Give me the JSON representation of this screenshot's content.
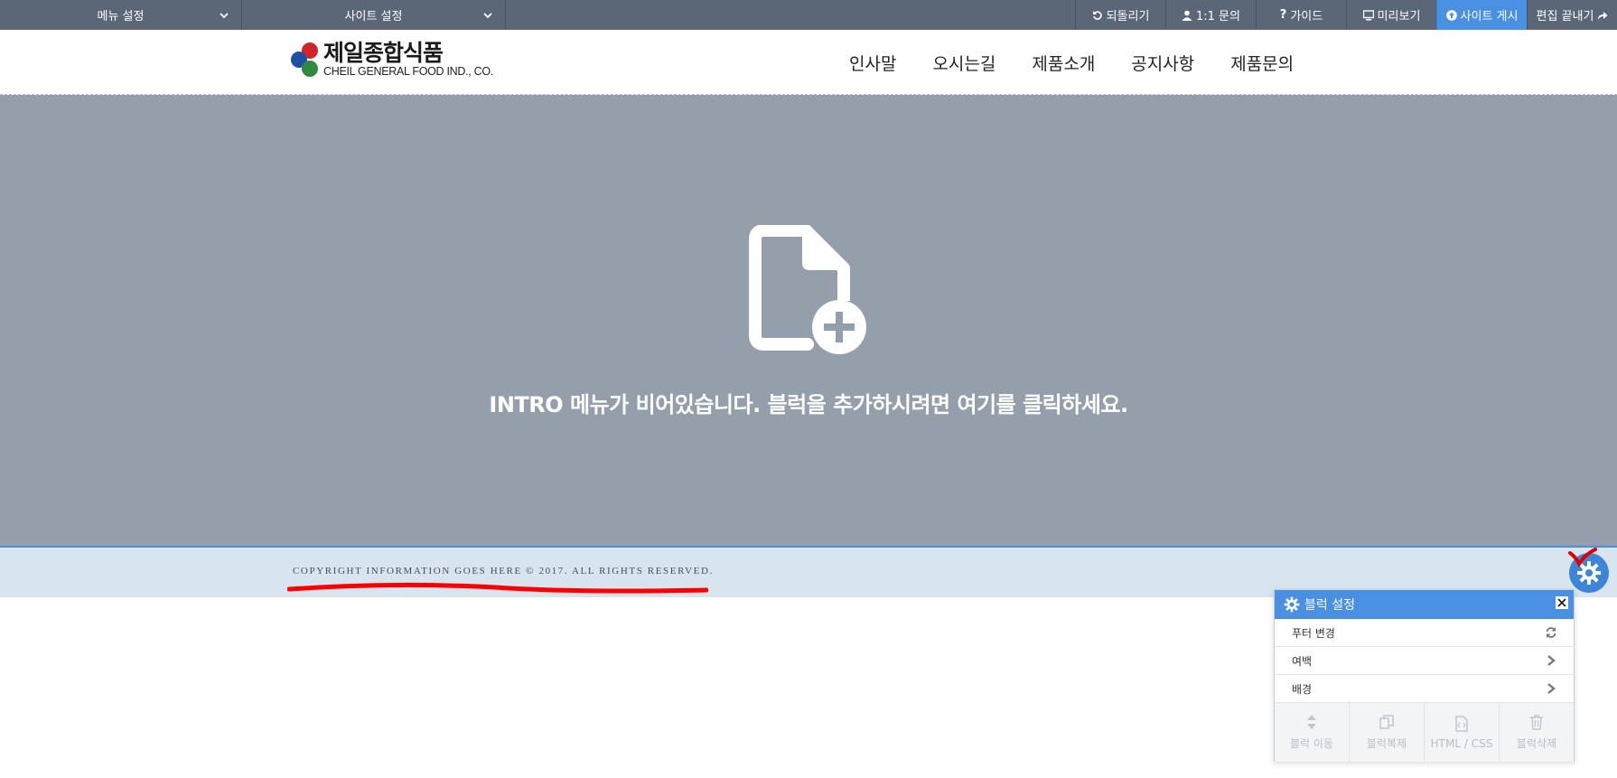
{
  "topbar": {
    "menu_settings": "메뉴 설정",
    "site_settings": "사이트 설정",
    "undo": "되돌리기",
    "support": "1:1 문의",
    "guide": "가이드",
    "preview": "미리보기",
    "publish": "사이트 게시",
    "finish": "편집 끝내기"
  },
  "logo": {
    "ko": "제일종합식품",
    "en": "CHEIL GENERAL FOOD IND., CO."
  },
  "nav": {
    "items": [
      "인사말",
      "오시는길",
      "제품소개",
      "공지사항",
      "제품문의"
    ]
  },
  "intro": {
    "message": "INTRO 메뉴가 비어있습니다. 블럭을 추가하시려면 여기를 클릭하세요."
  },
  "footer": {
    "copyright": "COPYRIGHT INFORMATION GOES HERE © 2017. ALL RIGHTS RESERVED."
  },
  "panel": {
    "title": "블럭 설정",
    "rows": [
      "푸터 변경",
      "여백",
      "배경"
    ],
    "tools": [
      "블럭 이동",
      "블럭복제",
      "HTML / CSS",
      "블럭삭제"
    ]
  },
  "colors": {
    "topbar": "#5b6677",
    "accent": "#4a90e2",
    "intro_bg": "#959fab",
    "footer_bg": "#d8e4ee"
  }
}
